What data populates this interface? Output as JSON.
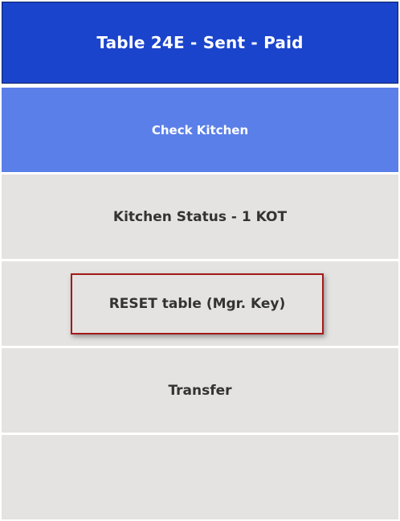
{
  "header": {
    "title": "Table 24E - Sent - Paid"
  },
  "menu": {
    "check_kitchen": "Check Kitchen",
    "kitchen_status": "Kitchen Status - 1 KOT",
    "reset_table": "RESET table (Mgr. Key)",
    "transfer": "Transfer",
    "empty": ""
  },
  "colors": {
    "header_bg": "#1b44cc",
    "active_row_bg": "#5b7fe8",
    "row_bg": "#e4e3e1",
    "highlight_border": "#a31a1a"
  }
}
